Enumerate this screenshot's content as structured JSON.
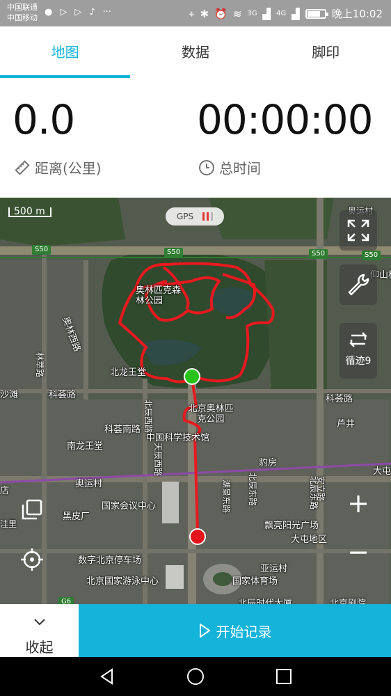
{
  "status_bar": {
    "carrier1": "中国联通",
    "carrier2": "中国移动",
    "network1": "3G",
    "network2": "4G",
    "time": "晚上10:02"
  },
  "tabs": [
    {
      "label": "地图",
      "active": true
    },
    {
      "label": "数据",
      "active": false
    },
    {
      "label": "脚印",
      "active": false
    }
  ],
  "stats": {
    "distance_value": "0.0",
    "distance_label": "距离(公里)",
    "time_value": "00:00:00",
    "time_label": "总时间"
  },
  "map": {
    "scale_label": "500 m",
    "gps_label": "GPS",
    "loop_label": "循迹9",
    "road_badges": [
      "S50",
      "S50",
      "S50",
      "S50",
      "G6"
    ],
    "places": [
      "奥林匹克森林公园",
      "奥林西路",
      "北辰西路",
      "北辰东路",
      "北龙王堂",
      "林萃路",
      "科荟路",
      "科荟路",
      "科荟南路",
      "沙滩",
      "南龙王堂",
      "北京奥林匹克公园",
      "中国科学技术馆",
      "大屯路",
      "奥运村",
      "国家会议中心",
      "湖景东路",
      "北辰东路",
      "天辰西路",
      "安立路",
      "豹房",
      "芦井",
      "飘亮阳光广场",
      "大屯地区",
      "数字北京停车场",
      "北京國家游泳中心",
      "国家体育场",
      "北辰时代大厦",
      "北京剧院",
      "亚运村",
      "仰山桥",
      "奥运村",
      "黑皮厂",
      "洼里",
      "店"
    ]
  },
  "bottom": {
    "collapse_label": "收起",
    "start_label": "开始记录"
  },
  "colors": {
    "accent": "#14b3d9",
    "track": "#e8191f",
    "start_marker": "#27c21a",
    "end_marker": "#e3141b"
  }
}
